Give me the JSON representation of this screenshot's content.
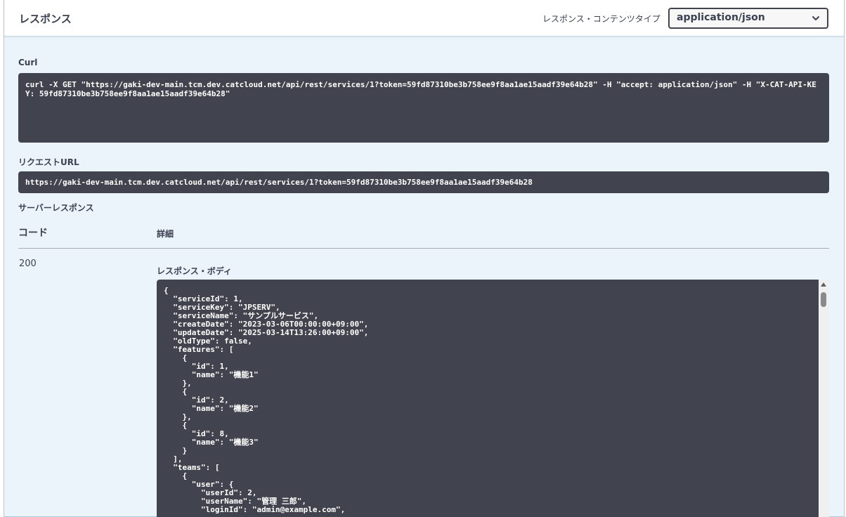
{
  "header": {
    "title": "レスポンス",
    "content_type_label": "レスポンス・コンテンツタイプ",
    "content_type_value": "application/json"
  },
  "curl": {
    "label": "Curl",
    "command": "curl -X GET \"https://gaki-dev-main.tcm.dev.catcloud.net/api/rest/services/1?token=59fd87310be3b758ee9f8aa1ae15aadf39e64b28\" -H \"accept: application/json\" -H \"X-CAT-API-KEY: 59fd87310be3b758ee9f8aa1ae15aadf39e64b28\""
  },
  "request_url": {
    "label": "リクエストURL",
    "value": "https://gaki-dev-main.tcm.dev.catcloud.net/api/rest/services/1?token=59fd87310be3b758ee9f8aa1ae15aadf39e64b28"
  },
  "server_response": {
    "label": "サーバーレスポンス",
    "col_code": "コード",
    "col_detail": "詳細",
    "status_code": "200",
    "body_label": "レスポンス・ボディ",
    "body": "{\n  \"serviceId\": 1,\n  \"serviceKey\": \"JPSERV\",\n  \"serviceName\": \"サンプルサービス\",\n  \"createDate\": \"2023-03-06T00:00:00+09:00\",\n  \"updateDate\": \"2025-03-14T13:26:00+09:00\",\n  \"oldType\": false,\n  \"features\": [\n    {\n      \"id\": 1,\n      \"name\": \"機能1\"\n    },\n    {\n      \"id\": 2,\n      \"name\": \"機能2\"\n    },\n    {\n      \"id\": 8,\n      \"name\": \"機能3\"\n    }\n  ],\n  \"teams\": [\n    {\n      \"user\": {\n        \"userId\": 2,\n        \"userName\": \"管理 三郎\",\n        \"loginId\": \"admin@example.com\","
  },
  "icons": {
    "select": "chevron-down-icon",
    "scroll_up": "scroll-up-arrow-icon"
  },
  "colors": {
    "panel_bg": "#ebf3fb",
    "code_bg": "#41444e",
    "text": "#3b4151"
  }
}
